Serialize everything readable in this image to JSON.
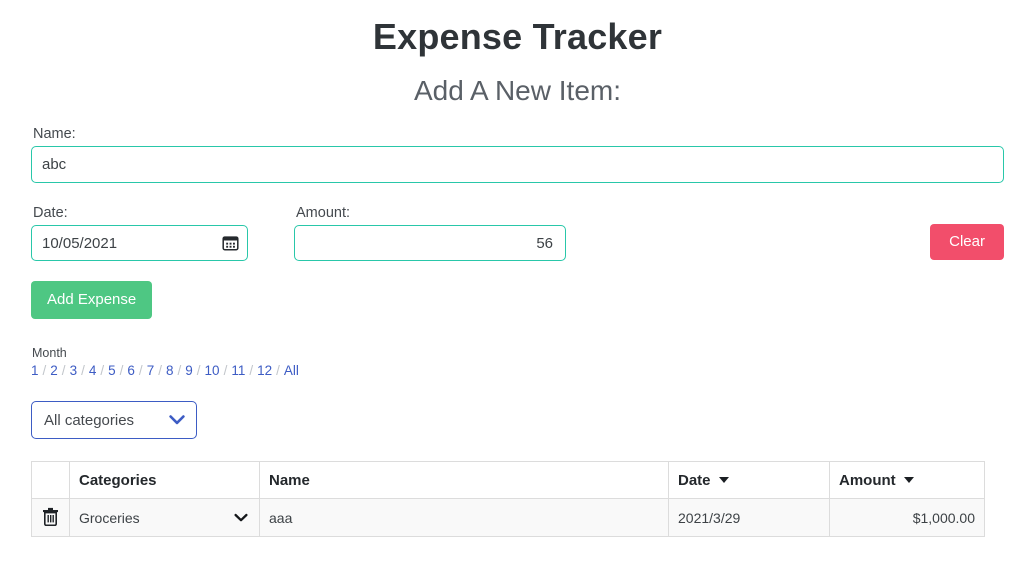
{
  "header": {
    "app_title": "Expense Tracker",
    "sub_title": "Add A New Item:"
  },
  "form": {
    "name_label": "Name:",
    "name_value": "abc",
    "name_placeholder": "",
    "date_label": "Date:",
    "date_value": "10/05/2021",
    "date_icon": "calendar-icon",
    "amount_label": "Amount:",
    "amount_value": "56",
    "amount_placeholder": "",
    "clear_label": "Clear",
    "add_label": "Add Expense"
  },
  "month_filter": {
    "label": "Month",
    "separator": "/",
    "items": [
      "1",
      "2",
      "3",
      "4",
      "5",
      "6",
      "7",
      "8",
      "9",
      "10",
      "11",
      "12",
      "All"
    ]
  },
  "category_filter": {
    "selected": "All categories",
    "options": [
      "All categories",
      "Groceries"
    ],
    "chevron_icon": "chevron-down-icon"
  },
  "table": {
    "columns": [
      {
        "key": "delete",
        "label": "",
        "sortable": false
      },
      {
        "key": "categories",
        "label": "Categories",
        "sortable": false
      },
      {
        "key": "name",
        "label": "Name",
        "sortable": false
      },
      {
        "key": "date",
        "label": "Date",
        "sortable": true
      },
      {
        "key": "amount",
        "label": "Amount",
        "sortable": true
      }
    ],
    "rows": [
      {
        "delete_icon": "trash-icon",
        "category": "Groceries",
        "name": "aaa",
        "date": "2021/3/29",
        "amount": "$1,000.00"
      }
    ]
  },
  "colors": {
    "input_border_teal": "#29c7a9",
    "clear_red": "#f24e6b",
    "add_green": "#4ec783",
    "link_blue": "#3d5cc4",
    "select_border_blue": "#3d5cc4",
    "title_dark": "#2f3438",
    "subtitle_gray": "#5a6067",
    "table_border": "#dcdcdc",
    "row_background": "#f9f9f9"
  }
}
